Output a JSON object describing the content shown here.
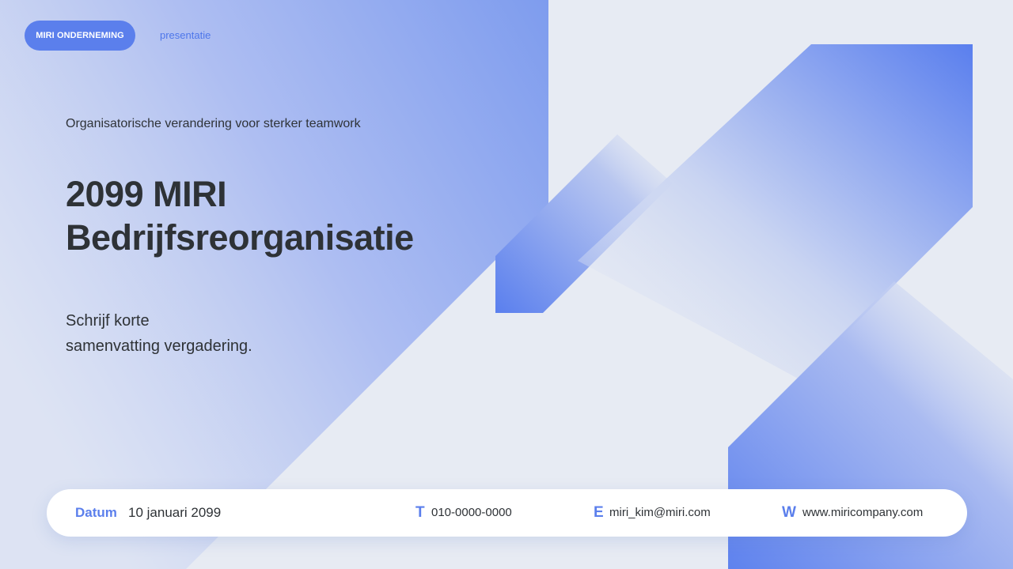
{
  "header": {
    "badge": "MIRI ONDERNEMING",
    "link": "presentatie"
  },
  "main": {
    "subtitle": "Organisatorische verandering voor sterker teamwork",
    "title_line1": "2099 MIRI",
    "title_line2": "Bedrijfsreorganisatie",
    "summary_line1": "Schrijf korte",
    "summary_line2": "samenvatting vergadering."
  },
  "footer": {
    "date_label": "Datum",
    "date_value": "10 januari 2099",
    "phone_label": "T",
    "phone_value": "010-0000-0000",
    "email_label": "E",
    "email_value": "miri_kim@miri.com",
    "web_label": "W",
    "web_value": "www.miricompany.com"
  },
  "colors": {
    "accent": "#5b7fec",
    "text": "#2e3236",
    "background": "#e7ebf3"
  }
}
